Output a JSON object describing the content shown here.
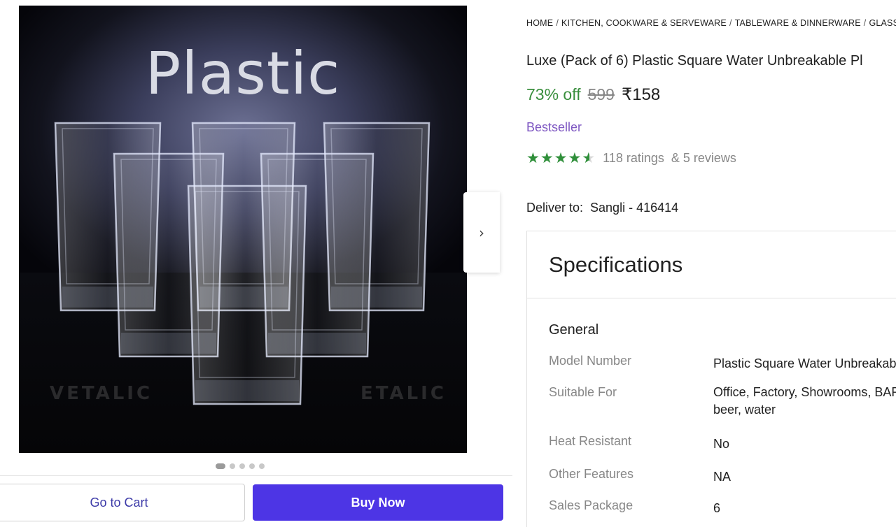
{
  "gallery": {
    "image_text": "Plastic",
    "watermark_left": "VETALIC",
    "watermark_right": "ETALIC",
    "next_icon": "chevron-right-icon",
    "next_glyph": "›",
    "dots_count": 5,
    "active_dot": 0
  },
  "actions": {
    "go_to_cart": "Go to Cart",
    "buy_now": "Buy Now",
    "buy_color": "#4d35e5"
  },
  "breadcrumb": [
    "HOME",
    "KITCHEN, COOKWARE & SERVEWARE",
    "TABLEWARE & DINNERWARE",
    "GLASS"
  ],
  "product": {
    "title": "Luxe (Pack of 6) Plastic Square Water Unbreakable Pl",
    "discount": "73% off",
    "mrp": "599",
    "price": "₹158",
    "badge": "Bestseller",
    "rating": 4.5,
    "ratings_count": "118 ratings",
    "reviews_count": "& 5 reviews",
    "deliver_label": "Deliver to:",
    "deliver_location": "Sangli - 416414"
  },
  "specifications": {
    "heading": "Specifications",
    "group": "General",
    "rows": [
      {
        "key": "Model Number",
        "value": "Plastic Square Water Unbreakab"
      },
      {
        "key": "Suitable For",
        "value": "Office, Factory, Showrooms, BAR beer, water"
      },
      {
        "key": "Heat Resistant",
        "value": "No"
      },
      {
        "key": "Other Features",
        "value": "NA"
      },
      {
        "key": "Sales Package",
        "value": "6"
      }
    ]
  }
}
